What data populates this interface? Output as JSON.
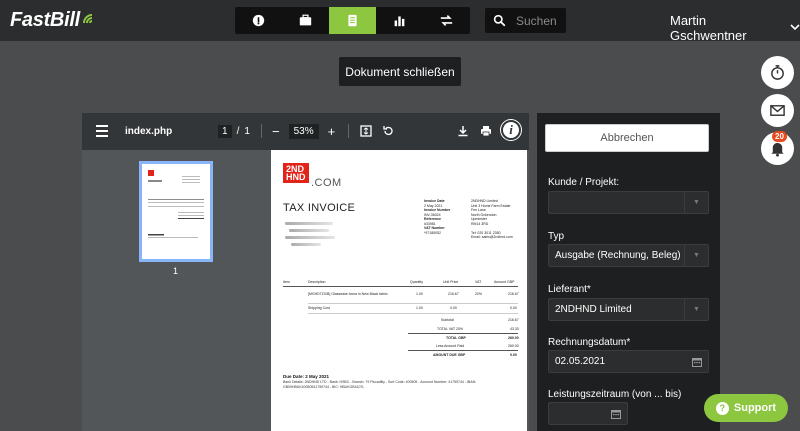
{
  "app": {
    "logo_text": "FastBill",
    "brand_color": "#8dc63f"
  },
  "nav": {
    "items": [
      {
        "icon": "dashboard-icon"
      },
      {
        "icon": "briefcase-icon"
      },
      {
        "icon": "document-icon",
        "active": true
      },
      {
        "icon": "bar-chart-icon"
      },
      {
        "icon": "transfer-icon"
      }
    ]
  },
  "search": {
    "placeholder": "Suchen"
  },
  "user": {
    "name": "Martin Gschwentner"
  },
  "close_document": {
    "label": "Dokument schließen"
  },
  "floating": {
    "notification_count": "20"
  },
  "viewer": {
    "filename": "index.php",
    "page_current": "1",
    "page_separator": "/",
    "page_total": "1",
    "zoom": "53%",
    "zoom_minus": "−",
    "zoom_plus": "+",
    "thumb_page": "1"
  },
  "invoice": {
    "logo_line1": "2ND",
    "logo_line2": "HND",
    "logo_suffix": ".COM",
    "title": "TAX INVOICE",
    "meta_labels": [
      "Invoice Date",
      "2 May 2021",
      "Invoice Number",
      "INV-36024",
      "Reference",
      "#33981",
      "VAT Number",
      "*97185052"
    ],
    "meta_address": [
      "2NDHND Limited",
      "Unit 3 Home Farm Estate",
      "Fen Lane",
      "North Ockendon",
      "Upminster",
      "RM14 3RD",
      "Tel: 020 3011 2380",
      "Email: sales@2ndhnd.com"
    ],
    "table_headers": {
      "item": "Item",
      "description": "Description",
      "quantity": "Quantity",
      "unit_price": "Unit Price",
      "vat": "VAT",
      "amount": "Amount GBP"
    },
    "rows": [
      {
        "item": "",
        "description": "[MGHD7ZX/B] Glassease Arma in New Black fabric",
        "quantity": "1.00",
        "unit_price": "216.67",
        "vat": "20%",
        "amount": "216.67"
      },
      {
        "item": "",
        "description": "Shipping Cost",
        "quantity": "1.00",
        "unit_price": "0.00",
        "vat": "",
        "amount": "0.00"
      }
    ],
    "subtotal_label": "Subtotal",
    "subtotal": "216.67",
    "vat_label": "TOTAL VAT 20%",
    "vat_total": "43.33",
    "total_label": "TOTAL GBP",
    "total": "260.00",
    "paid_label": "Less Amount Paid",
    "paid": "260.00",
    "due_label": "AMOUNT DUE GBP",
    "due": "0.00",
    "due_date": "Due Date: 2 May 2021",
    "bank_details": "Bank Details: 2NDHND LTD - Bank: HSBC - Branch: 79 Piccadilly - Sort Code: 400505 - Account Number: 41759744 - IBAN: GB09HBUK40050541759744 - BIC: HBUKGB4107L"
  },
  "form": {
    "cancel_label": "Abbrechen",
    "customer_label": "Kunde / Projekt:",
    "customer_value": "",
    "type_label": "Typ",
    "type_value": "Ausgabe (Rechnung, Beleg)",
    "supplier_label": "Lieferant*",
    "supplier_value": "2NDHND Limited",
    "invoice_date_label": "Rechnungsdatum*",
    "invoice_date_value": "02.05.2021",
    "service_period_label": "Leistungszeitraum (von ... bis)",
    "service_period_value": ""
  },
  "support": {
    "label": "Support"
  }
}
